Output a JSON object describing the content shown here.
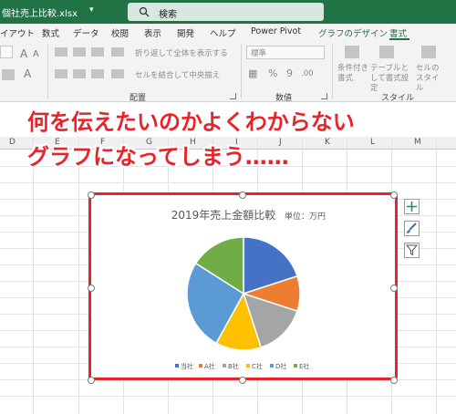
{
  "titlebar": {
    "filename": "個社売上比較.xlsx",
    "search": "検索"
  },
  "tabs": [
    {
      "label": "イアウト"
    },
    {
      "label": "数式"
    },
    {
      "label": "データ"
    },
    {
      "label": "校閲"
    },
    {
      "label": "表示"
    },
    {
      "label": "開発"
    },
    {
      "label": "ヘルプ"
    },
    {
      "label": "Power Pivot"
    },
    {
      "label": "グラフのデザイン"
    },
    {
      "label": "書式"
    }
  ],
  "ribbon": {
    "wrap_text": "折り返して全体を表示する",
    "merge_center": "セルを結合して中央揃え",
    "number_format": "標準",
    "conditional": "条件付き書式",
    "as_table": "テーブルとして書式設定",
    "cell_style": "セルのスタイル",
    "group_alignment": "配置",
    "group_number": "数値",
    "group_styles": "スタイル"
  },
  "columns": [
    "D",
    "E",
    "F",
    "G",
    "H",
    "I",
    "J",
    "K",
    "L",
    "M"
  ],
  "captions": {
    "line1": "何を伝えたいのかよくわからない",
    "line2": "グラフになってしまう……"
  },
  "chart_data": {
    "type": "pie",
    "title": "2019年売上金額比較",
    "unit": "単位：万円",
    "categories": [
      "当社",
      "A社",
      "B社",
      "C社",
      "D社",
      "E社"
    ],
    "values": [
      20,
      10,
      15,
      13,
      26,
      16
    ],
    "colors": [
      "#4472c4",
      "#ed7d31",
      "#a5a5a5",
      "#ffc000",
      "#5b9bd5",
      "#70ad47"
    ],
    "legend_position": "bottom"
  }
}
